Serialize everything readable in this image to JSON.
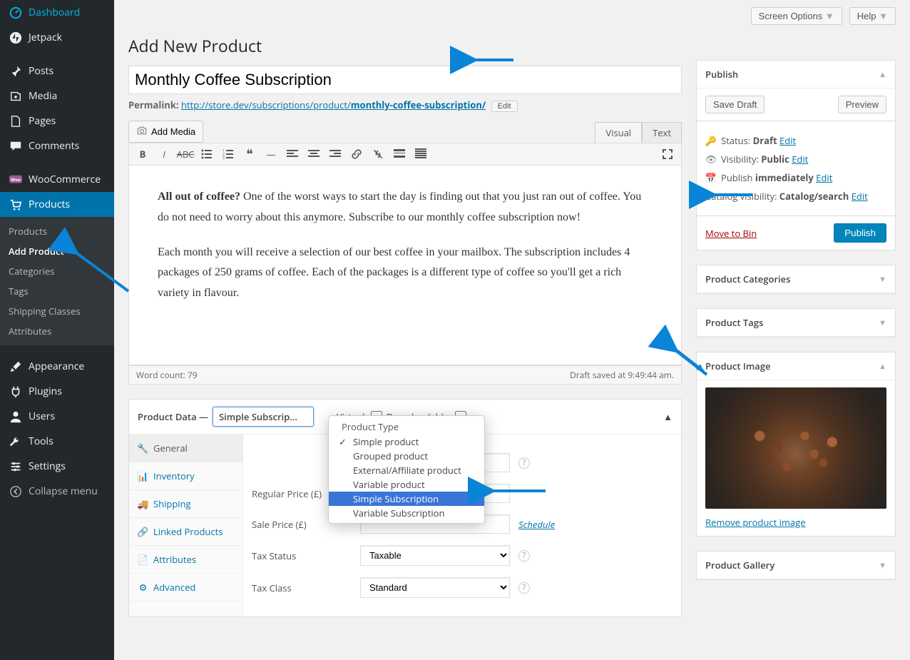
{
  "topbar": {
    "screen_options": "Screen Options",
    "help": "Help"
  },
  "sidebar": {
    "items": [
      {
        "label": "Dashboard",
        "icon": "dashboard-icon"
      },
      {
        "label": "Jetpack",
        "icon": "jetpack-icon"
      },
      {
        "label": "Posts",
        "icon": "pin-icon"
      },
      {
        "label": "Media",
        "icon": "media-icon"
      },
      {
        "label": "Pages",
        "icon": "page-icon"
      },
      {
        "label": "Comments",
        "icon": "comment-icon"
      },
      {
        "label": "WooCommerce",
        "icon": "woo-icon"
      },
      {
        "label": "Products",
        "icon": "cart-icon"
      },
      {
        "label": "Appearance",
        "icon": "brush-icon"
      },
      {
        "label": "Plugins",
        "icon": "plug-icon"
      },
      {
        "label": "Users",
        "icon": "user-icon"
      },
      {
        "label": "Tools",
        "icon": "wrench-icon"
      },
      {
        "label": "Settings",
        "icon": "sliders-icon"
      },
      {
        "label": "Collapse menu",
        "icon": "collapse-icon"
      }
    ],
    "sub": [
      "Products",
      "Add Product",
      "Categories",
      "Tags",
      "Shipping Classes",
      "Attributes"
    ]
  },
  "page_title": "Add New Product",
  "title_value": "Monthly Coffee Subscription",
  "permalink": {
    "label": "Permalink:",
    "base": "http://store.dev/subscriptions/product/",
    "slug": "monthly-coffee-subscription/",
    "edit": "Edit"
  },
  "add_media": "Add Media",
  "editor_tabs": {
    "visual": "Visual",
    "text": "Text"
  },
  "content": {
    "lead_bold": "All out of coffee?",
    "lead_rest": " One of the worst ways to start the day is finding out that you just ran out of coffee. You do not need to worry about this anymore. Subscribe to our monthly coffee subscription now!",
    "p2": "Each month you will receive a selection of our best coffee in your mailbox. The subscription includes 4 packages of 250 grams of coffee. Each of the packages is a different type of coffee so you'll get a rich variety in flavour."
  },
  "word_count_label": "Word count: ",
  "word_count": "79",
  "draft_saved": "Draft saved at 9:49:44 am.",
  "product_data": {
    "title": "Product Data —",
    "virtual": "Virtual:",
    "downloadable": "Downloadable:",
    "tabs": [
      "General",
      "Inventory",
      "Shipping",
      "Linked Products",
      "Attributes",
      "Advanced"
    ],
    "fields": {
      "regular_price": "Regular Price (£)",
      "sale_price": "Sale Price (£)",
      "schedule": "Schedule",
      "tax_status": "Tax Status",
      "tax_status_value": "Taxable",
      "tax_class": "Tax Class",
      "tax_class_value": "Standard"
    }
  },
  "dropdown": {
    "group": "Product Type",
    "options": [
      "Simple product",
      "Grouped product",
      "External/Affiliate product",
      "Variable product",
      "Simple Subscription",
      "Variable Subscription"
    ],
    "selected": "Simple Subscription",
    "checked": "Simple product"
  },
  "publish": {
    "title": "Publish",
    "save_draft": "Save Draft",
    "preview": "Preview",
    "status_label": "Status: ",
    "status_value": "Draft",
    "visibility_label": "Visibility: ",
    "visibility_value": "Public",
    "publish_label": "Publish ",
    "publish_value": "immediately",
    "catalog_label": "Catalog visibility: ",
    "catalog_value": "Catalog/search",
    "edit": "Edit",
    "move_to_bin": "Move to Bin",
    "publish_btn": "Publish"
  },
  "panels": {
    "categories": "Product Categories",
    "tags": "Product Tags",
    "image": "Product Image",
    "remove_image": "Remove product image",
    "gallery": "Product Gallery"
  }
}
